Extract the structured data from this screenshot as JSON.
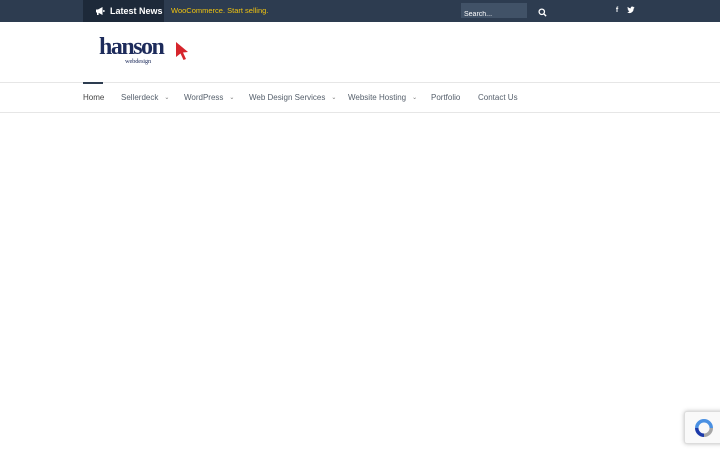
{
  "topbar": {
    "latest_label": "Latest News",
    "ticker_text": "WooCommerce. Start selling.",
    "search_placeholder": "Search...",
    "icons": [
      "megaphone-icon",
      "search-icon",
      "facebook-icon",
      "twitter-icon"
    ]
  },
  "social": {
    "facebook_glyph": "f",
    "twitter_glyph": "t"
  },
  "logo": {
    "brand": "hanson",
    "sub": "webdesign"
  },
  "nav": {
    "items": [
      {
        "label": "Home",
        "has_dropdown": false,
        "active": true
      },
      {
        "label": "Sellerdeck",
        "has_dropdown": true
      },
      {
        "label": "WordPress",
        "has_dropdown": true
      },
      {
        "label": "Web Design Services",
        "has_dropdown": true
      },
      {
        "label": "Website Hosting",
        "has_dropdown": true
      },
      {
        "label": "Portfolio",
        "has_dropdown": false
      },
      {
        "label": "Contact Us",
        "has_dropdown": false
      }
    ],
    "chevron": "⌄"
  },
  "colors": {
    "topbar_bg": "#2d3c50",
    "latest_bg": "#1d2939",
    "ticker": "#f1c40f",
    "brand_navy": "#1d2b5b",
    "brand_red": "#d6252c"
  }
}
